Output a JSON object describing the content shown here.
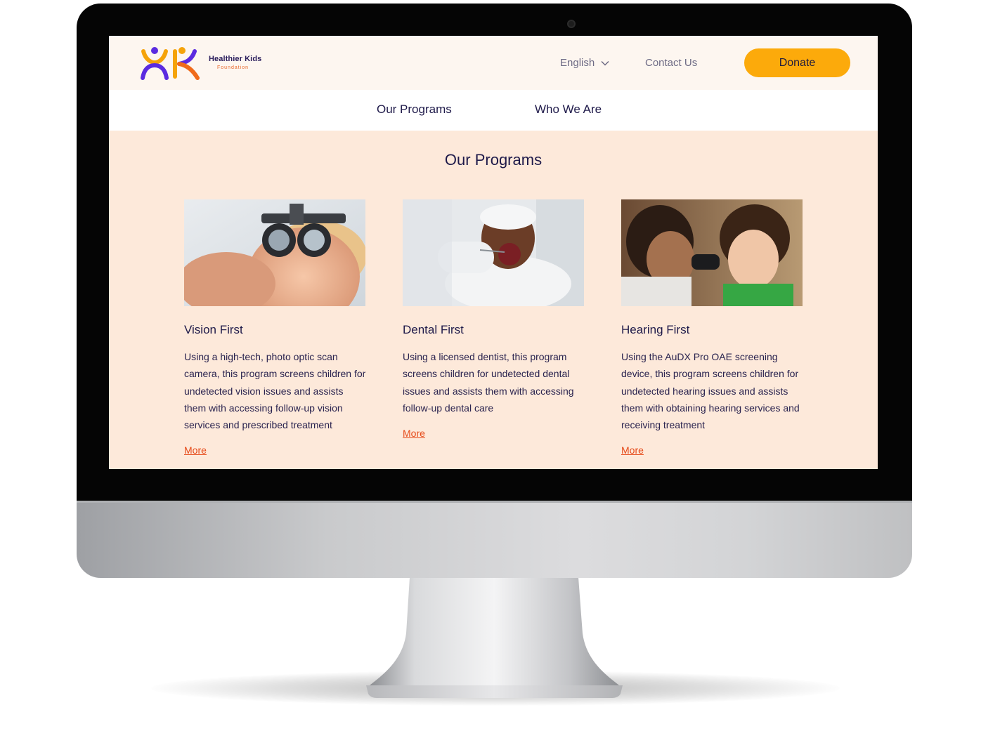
{
  "brand": {
    "name": "Healthier Kids",
    "subtitle": "Foundation"
  },
  "header": {
    "language": "English",
    "contact_label": "Contact Us",
    "donate_label": "Donate"
  },
  "nav": {
    "items": [
      {
        "label": "Our Programs"
      },
      {
        "label": "Who We Are"
      }
    ]
  },
  "programs": {
    "title": "Our Programs",
    "cards": [
      {
        "title": "Vision First",
        "description": "Using a high-tech, photo optic scan camera, this program screens children for undetected vision issues and assists them with accessing follow-up vision services and prescribed treatment",
        "more_label": "More"
      },
      {
        "title": "Dental First",
        "description": "Using a licensed dentist, this program screens children for undetected dental issues and assists  them with accessing follow-up dental care",
        "more_label": "More"
      },
      {
        "title": "Hearing First",
        "description": "Using the AuDX Pro OAE screening device, this program screens children for undetected hearing issues and assists them with obtaining hearing services and receiving treatment",
        "more_label": "More"
      }
    ]
  },
  "colors": {
    "accent_donate": "#fcaa0b",
    "link": "#e64a19",
    "heading": "#1f1a4a",
    "section_bg": "#fde9da",
    "topbar_bg": "#fdf6f0"
  }
}
